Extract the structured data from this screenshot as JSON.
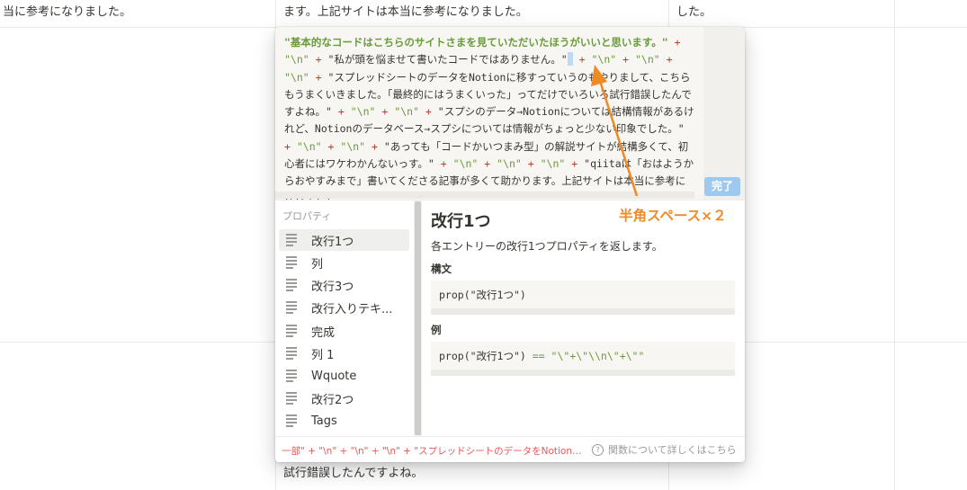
{
  "background": {
    "row1_col1": "当に参考になりました。",
    "row1_col2": "ます。上記サイトは本当に参考になりました。",
    "row1_col3": "した。",
    "row2_col2": "試行錯誤したんですよね。"
  },
  "editor": {
    "line_text": "\"基本的なコードはこちらのサイトさまを見ていただいたほうがいいと思います。\" + \"\\n\" + \"私が頭を悩ませて書いたコードではありません。\" + \"\\n\" + \"\\n\" + \"\\n\" + \"スプレッドシートのデータをNotionに移すっていうのもやりまして、こちらもうまくいきました。「最終的にはうまくいった」ってだけでいろいろ試行錯誤したんですよね。\" + \"\\n\" + \"\\n\" + \"スプシのデータ→Notionについては結構情報があるけれど、Notionのデータベース→スプシについては情報がちょっと少ない印象でした。\" + \"\\n\" + \"\\n\" + \"あっても「コードかいつまみ型」の解説サイトが結構多くて、初心者にはワケわかんないっす。\" + \"\\n\" + \"\\n\" + \"\\n\" + \"qiitaは「おはようからおやすみまで」書いてくださる記事が多くて助かります。上記サイトは本当に参考になりました。\"",
    "seg1": "\"基本的なコードはこちらのサイトさまを見ていただいたほうがいいと思います。\"",
    "seg2": "\"\\n\"",
    "seg3": "\"私が頭を悩ませて書いたコードではありません。\"",
    "seg4": "\"スプレッドシートのデータをNotionに移すっていうのもやりまして、こちらもうまくいきました。「最終的にはうまくいった」ってだけでいろいろ試行錯誤したんですよね。\"",
    "seg5": "\"スプシのデータ→Notionについては結構情報があるけれど、Notionのデータベース→スプシについては情報がちょっと少ない印象でした。\"",
    "seg6": "\"あっても「コードかいつまみ型」の解説サイトが結構多くて、初心者にはワケわかんないっす。\"",
    "seg7": "\"qiitaは「おはようからおやすみまで」書いてくださる記事が多くて助かります。上記サイトは本当に参考になりました。\"",
    "plus": "+",
    "done_label": "完了"
  },
  "sidebar": {
    "heading": "プロパティ",
    "items": [
      {
        "label": "改行1つ"
      },
      {
        "label": "列"
      },
      {
        "label": "改行3つ"
      },
      {
        "label": "改行入りテキ..."
      },
      {
        "label": "完成"
      },
      {
        "label": "列 1"
      },
      {
        "label": "Wquote"
      },
      {
        "label": "改行2つ"
      },
      {
        "label": "Tags"
      }
    ]
  },
  "doc": {
    "title": "改行1つ",
    "description": "各エントリーの改行1つプロパティを返します。",
    "syntax_heading": "構文",
    "syntax_code": "prop(\"改行1つ\")",
    "example_heading": "例",
    "example_code_prefix": "prop(\"改行1つ\")",
    "example_code_op": "==",
    "example_code_str": "\"\\\"+\\\"\\\\n\\\"+\\\"\""
  },
  "footer": {
    "error_text": "一部\" + \"\\n\" + \"\\n\" + \"\\n\" + \"スプレッドシートのデータをNotionに...",
    "help_text": "関数について詳しくはこちら",
    "help_icon": "question-circle-icon"
  },
  "annotation": {
    "label": "半角スペース×２",
    "color": "#f08a24"
  }
}
